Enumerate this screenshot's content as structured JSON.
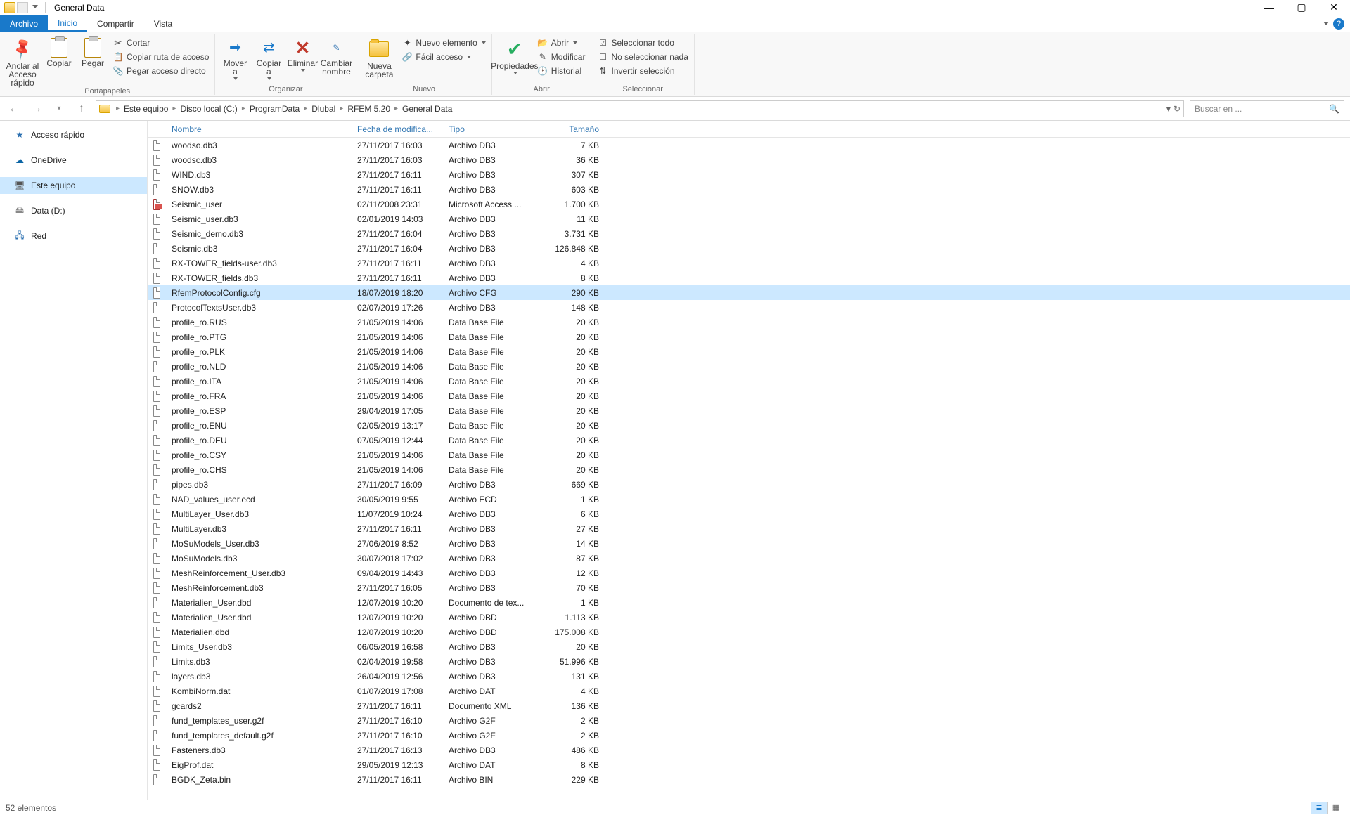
{
  "window": {
    "title": "General Data"
  },
  "tabs": {
    "archivo": "Archivo",
    "inicio": "Inicio",
    "compartir": "Compartir",
    "vista": "Vista"
  },
  "ribbon": {
    "portapapeles": {
      "label": "Portapapeles",
      "anclar": "Anclar al\nAcceso rápido",
      "copiar": "Copiar",
      "pegar": "Pegar",
      "cortar": "Cortar",
      "ruta": "Copiar ruta de acceso",
      "directo": "Pegar acceso directo"
    },
    "organizar": {
      "label": "Organizar",
      "mover": "Mover\na",
      "copiar": "Copiar\na",
      "eliminar": "Eliminar",
      "cambiar": "Cambiar\nnombre"
    },
    "nuevo": {
      "label": "Nuevo",
      "carpeta": "Nueva\ncarpeta",
      "elemento": "Nuevo elemento",
      "facil": "Fácil acceso"
    },
    "abrir": {
      "label": "Abrir",
      "propiedades": "Propiedades",
      "abrir": "Abrir",
      "modificar": "Modificar",
      "historial": "Historial"
    },
    "seleccionar": {
      "label": "Seleccionar",
      "todo": "Seleccionar todo",
      "nada": "No seleccionar nada",
      "invertir": "Invertir selección"
    }
  },
  "breadcrumb": [
    "Este equipo",
    "Disco local (C:)",
    "ProgramData",
    "Dlubal",
    "RFEM 5.20",
    "General Data"
  ],
  "search_placeholder": "Buscar en ...",
  "sidebar": {
    "acceso": "Acceso rápido",
    "onedrive": "OneDrive",
    "equipo": "Este equipo",
    "data": "Data (D:)",
    "red": "Red"
  },
  "columns": {
    "nombre": "Nombre",
    "fecha": "Fecha de modifica...",
    "tipo": "Tipo",
    "tamano": "Tamaño"
  },
  "files": [
    {
      "name": "woodso.db3",
      "date": "27/11/2017 16:03",
      "type": "Archivo DB3",
      "size": "7 KB",
      "ico": "file"
    },
    {
      "name": "woodsc.db3",
      "date": "27/11/2017 16:03",
      "type": "Archivo DB3",
      "size": "36 KB",
      "ico": "file"
    },
    {
      "name": "WIND.db3",
      "date": "27/11/2017 16:11",
      "type": "Archivo DB3",
      "size": "307 KB",
      "ico": "file"
    },
    {
      "name": "SNOW.db3",
      "date": "27/11/2017 16:11",
      "type": "Archivo DB3",
      "size": "603 KB",
      "ico": "file"
    },
    {
      "name": "Seismic_user",
      "date": "02/11/2008 23:31",
      "type": "Microsoft Access ...",
      "size": "1.700 KB",
      "ico": "mdb"
    },
    {
      "name": "Seismic_user.db3",
      "date": "02/01/2019 14:03",
      "type": "Archivo DB3",
      "size": "11 KB",
      "ico": "file"
    },
    {
      "name": "Seismic_demo.db3",
      "date": "27/11/2017 16:04",
      "type": "Archivo DB3",
      "size": "3.731 KB",
      "ico": "file"
    },
    {
      "name": "Seismic.db3",
      "date": "27/11/2017 16:04",
      "type": "Archivo DB3",
      "size": "126.848 KB",
      "ico": "file"
    },
    {
      "name": "RX-TOWER_fields-user.db3",
      "date": "27/11/2017 16:11",
      "type": "Archivo DB3",
      "size": "4 KB",
      "ico": "file"
    },
    {
      "name": "RX-TOWER_fields.db3",
      "date": "27/11/2017 16:11",
      "type": "Archivo DB3",
      "size": "8 KB",
      "ico": "file"
    },
    {
      "name": "RfemProtocolConfig.cfg",
      "date": "18/07/2019 18:20",
      "type": "Archivo CFG",
      "size": "290 KB",
      "ico": "file",
      "selected": true
    },
    {
      "name": "ProtocolTextsUser.db3",
      "date": "02/07/2019 17:26",
      "type": "Archivo DB3",
      "size": "148 KB",
      "ico": "file"
    },
    {
      "name": "profile_ro.RUS",
      "date": "21/05/2019 14:06",
      "type": "Data Base File",
      "size": "20 KB",
      "ico": "file"
    },
    {
      "name": "profile_ro.PTG",
      "date": "21/05/2019 14:06",
      "type": "Data Base File",
      "size": "20 KB",
      "ico": "file"
    },
    {
      "name": "profile_ro.PLK",
      "date": "21/05/2019 14:06",
      "type": "Data Base File",
      "size": "20 KB",
      "ico": "file"
    },
    {
      "name": "profile_ro.NLD",
      "date": "21/05/2019 14:06",
      "type": "Data Base File",
      "size": "20 KB",
      "ico": "file"
    },
    {
      "name": "profile_ro.ITA",
      "date": "21/05/2019 14:06",
      "type": "Data Base File",
      "size": "20 KB",
      "ico": "file"
    },
    {
      "name": "profile_ro.FRA",
      "date": "21/05/2019 14:06",
      "type": "Data Base File",
      "size": "20 KB",
      "ico": "file"
    },
    {
      "name": "profile_ro.ESP",
      "date": "29/04/2019 17:05",
      "type": "Data Base File",
      "size": "20 KB",
      "ico": "file"
    },
    {
      "name": "profile_ro.ENU",
      "date": "02/05/2019 13:17",
      "type": "Data Base File",
      "size": "20 KB",
      "ico": "file"
    },
    {
      "name": "profile_ro.DEU",
      "date": "07/05/2019 12:44",
      "type": "Data Base File",
      "size": "20 KB",
      "ico": "file"
    },
    {
      "name": "profile_ro.CSY",
      "date": "21/05/2019 14:06",
      "type": "Data Base File",
      "size": "20 KB",
      "ico": "file"
    },
    {
      "name": "profile_ro.CHS",
      "date": "21/05/2019 14:06",
      "type": "Data Base File",
      "size": "20 KB",
      "ico": "file"
    },
    {
      "name": "pipes.db3",
      "date": "27/11/2017 16:09",
      "type": "Archivo DB3",
      "size": "669 KB",
      "ico": "file"
    },
    {
      "name": "NAD_values_user.ecd",
      "date": "30/05/2019 9:55",
      "type": "Archivo ECD",
      "size": "1 KB",
      "ico": "file"
    },
    {
      "name": "MultiLayer_User.db3",
      "date": "11/07/2019 10:24",
      "type": "Archivo DB3",
      "size": "6 KB",
      "ico": "file"
    },
    {
      "name": "MultiLayer.db3",
      "date": "27/11/2017 16:11",
      "type": "Archivo DB3",
      "size": "27 KB",
      "ico": "file"
    },
    {
      "name": "MoSuModels_User.db3",
      "date": "27/06/2019 8:52",
      "type": "Archivo DB3",
      "size": "14 KB",
      "ico": "file"
    },
    {
      "name": "MoSuModels.db3",
      "date": "30/07/2018 17:02",
      "type": "Archivo DB3",
      "size": "87 KB",
      "ico": "file"
    },
    {
      "name": "MeshReinforcement_User.db3",
      "date": "09/04/2019 14:43",
      "type": "Archivo DB3",
      "size": "12 KB",
      "ico": "file"
    },
    {
      "name": "MeshReinforcement.db3",
      "date": "27/11/2017 16:05",
      "type": "Archivo DB3",
      "size": "70 KB",
      "ico": "file"
    },
    {
      "name": "Materialien_User.dbd",
      "date": "12/07/2019 10:20",
      "type": "Documento de tex...",
      "size": "1 KB",
      "ico": "file"
    },
    {
      "name": "Materialien_User.dbd",
      "date": "12/07/2019 10:20",
      "type": "Archivo DBD",
      "size": "1.113 KB",
      "ico": "file"
    },
    {
      "name": "Materialien.dbd",
      "date": "12/07/2019 10:20",
      "type": "Archivo DBD",
      "size": "175.008 KB",
      "ico": "file"
    },
    {
      "name": "Limits_User.db3",
      "date": "06/05/2019 16:58",
      "type": "Archivo DB3",
      "size": "20 KB",
      "ico": "file"
    },
    {
      "name": "Limits.db3",
      "date": "02/04/2019 19:58",
      "type": "Archivo DB3",
      "size": "51.996 KB",
      "ico": "file"
    },
    {
      "name": "layers.db3",
      "date": "26/04/2019 12:56",
      "type": "Archivo DB3",
      "size": "131 KB",
      "ico": "file"
    },
    {
      "name": "KombiNorm.dat",
      "date": "01/07/2019 17:08",
      "type": "Archivo DAT",
      "size": "4 KB",
      "ico": "file"
    },
    {
      "name": "gcards2",
      "date": "27/11/2017 16:11",
      "type": "Documento XML",
      "size": "136 KB",
      "ico": "file"
    },
    {
      "name": "fund_templates_user.g2f",
      "date": "27/11/2017 16:10",
      "type": "Archivo G2F",
      "size": "2 KB",
      "ico": "file"
    },
    {
      "name": "fund_templates_default.g2f",
      "date": "27/11/2017 16:10",
      "type": "Archivo G2F",
      "size": "2 KB",
      "ico": "file"
    },
    {
      "name": "Fasteners.db3",
      "date": "27/11/2017 16:13",
      "type": "Archivo DB3",
      "size": "486 KB",
      "ico": "file"
    },
    {
      "name": "EigProf.dat",
      "date": "29/05/2019 12:13",
      "type": "Archivo DAT",
      "size": "8 KB",
      "ico": "file"
    },
    {
      "name": "BGDK_Zeta.bin",
      "date": "27/11/2017 16:11",
      "type": "Archivo BIN",
      "size": "229 KB",
      "ico": "file"
    }
  ],
  "status": "52 elementos"
}
